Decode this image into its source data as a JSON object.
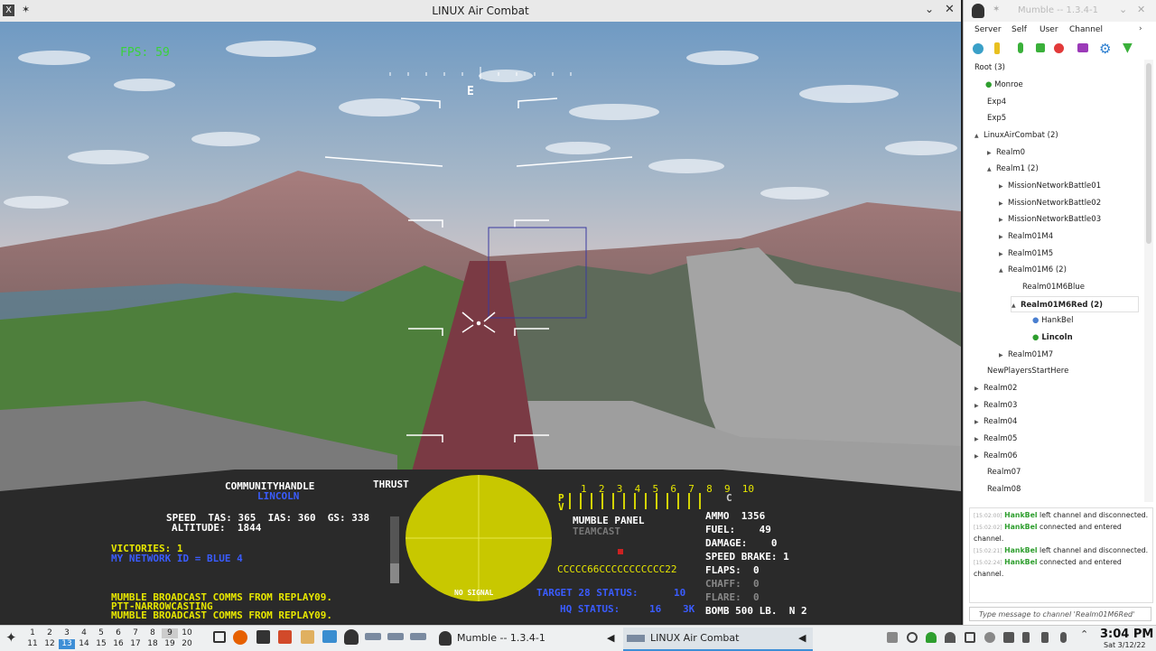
{
  "game": {
    "window_title": "LINUX Air Combat",
    "fps": "FPS: 59",
    "compass": "E",
    "handle": "COMMUNITYHANDLE",
    "player_name": "LINCOLN",
    "thrust_label": "THRUST",
    "speed_line": "SPEED  TAS: 365  IAS: 360  GS: 338",
    "altitude_line": "ALTITUDE:  1844",
    "victories": "VICTORIES: 1",
    "network_id": "MY NETWORK ID = BLUE 4",
    "broadcast_lines": [
      "MUMBLE BROADCAST COMMS FROM REPLAY09.",
      "PTT-NARROWCASTING",
      "MUMBLE BROADCAST COMMS FROM REPLAY09."
    ],
    "radar_status": "NO SIGNAL",
    "player_numbers": "1  2  3  4  5  6  7  8  9  10",
    "row_p": "P",
    "row_v": "V",
    "col_c": "C",
    "mumble_panel": "MUMBLE PANEL",
    "teamcast": "TEAMCAST",
    "code_string": "CCCCC66CCCCCCCCCCC22",
    "target_status": "TARGET 28 STATUS:",
    "target_status_value": "10",
    "hq_status": "HQ STATUS:",
    "hq_value_1": "16",
    "hq_value_2": "3K",
    "ammo": "AMMO  1356",
    "fuel": "FUEL:    49",
    "damage": "DAMAGE:    0",
    "speed_brake": "SPEED BRAKE: 1",
    "flaps": "FLAPS:  0",
    "chaff": "CHAFF:  0",
    "flare": "FLARE:  0",
    "bomb": "BOMB 500 LB.  N 2"
  },
  "mumble": {
    "window_title": "Mumble -- 1.3.4-1",
    "menu": [
      "Server",
      "Self",
      "User",
      "Channel"
    ],
    "tree": [
      {
        "label": "Root (3)"
      },
      {
        "label": "Monroe"
      },
      {
        "label": "Exp4"
      },
      {
        "label": "Exp5"
      },
      {
        "label": "LinuxAirCombat (2)"
      },
      {
        "label": "Realm0"
      },
      {
        "label": "Realm1 (2)"
      },
      {
        "label": "MissionNetworkBattle01"
      },
      {
        "label": "MissionNetworkBattle02"
      },
      {
        "label": "MissionNetworkBattle03"
      },
      {
        "label": "Realm01M4"
      },
      {
        "label": "Realm01M5"
      },
      {
        "label": "Realm01M6 (2)"
      },
      {
        "label": "Realm01M6Blue"
      },
      {
        "label": "Realm01M6Red (2)"
      },
      {
        "label": "HankBel"
      },
      {
        "label": "Lincoln"
      },
      {
        "label": "Realm01M7"
      },
      {
        "label": "NewPlayersStartHere"
      },
      {
        "label": "Realm02"
      },
      {
        "label": "Realm03"
      },
      {
        "label": "Realm04"
      },
      {
        "label": "Realm05"
      },
      {
        "label": "Realm06"
      },
      {
        "label": "Realm07"
      },
      {
        "label": "Realm08"
      }
    ],
    "log": [
      {
        "time": "[15:02:00]",
        "user": "HankBel",
        "text": " left channel and disconnected."
      },
      {
        "time": "[15:02:02]",
        "user": "HankBel",
        "text": " connected and entered channel."
      },
      {
        "time": "[15:02:21]",
        "user": "HankBel",
        "text": " left channel and disconnected."
      },
      {
        "time": "[15:02:24]",
        "user": "HankBel",
        "text": " connected and entered channel."
      }
    ],
    "message_placeholder": "Type message to channel 'Realm01M6Red' here"
  },
  "taskbar": {
    "workspaces_top": [
      "1",
      "2",
      "3",
      "4",
      "5",
      "6",
      "7",
      "8",
      "9",
      "10"
    ],
    "workspaces_bottom": [
      "11",
      "12",
      "13",
      "14",
      "15",
      "16",
      "17",
      "18",
      "19",
      "20"
    ],
    "task_mumble": "Mumble -- 1.3.4-1",
    "task_game": "LINUX Air Combat",
    "clock_time": "3:04 PM",
    "clock_date": "Sat 3/12/22"
  },
  "colors": {
    "hud_green": "#3ad23a",
    "hud_yellow": "#e6e600",
    "hud_blue": "#3a5cff",
    "hud_white": "#ffffff",
    "radar_fill": "#c8c800",
    "mumble_green": "#2e9e2e"
  }
}
